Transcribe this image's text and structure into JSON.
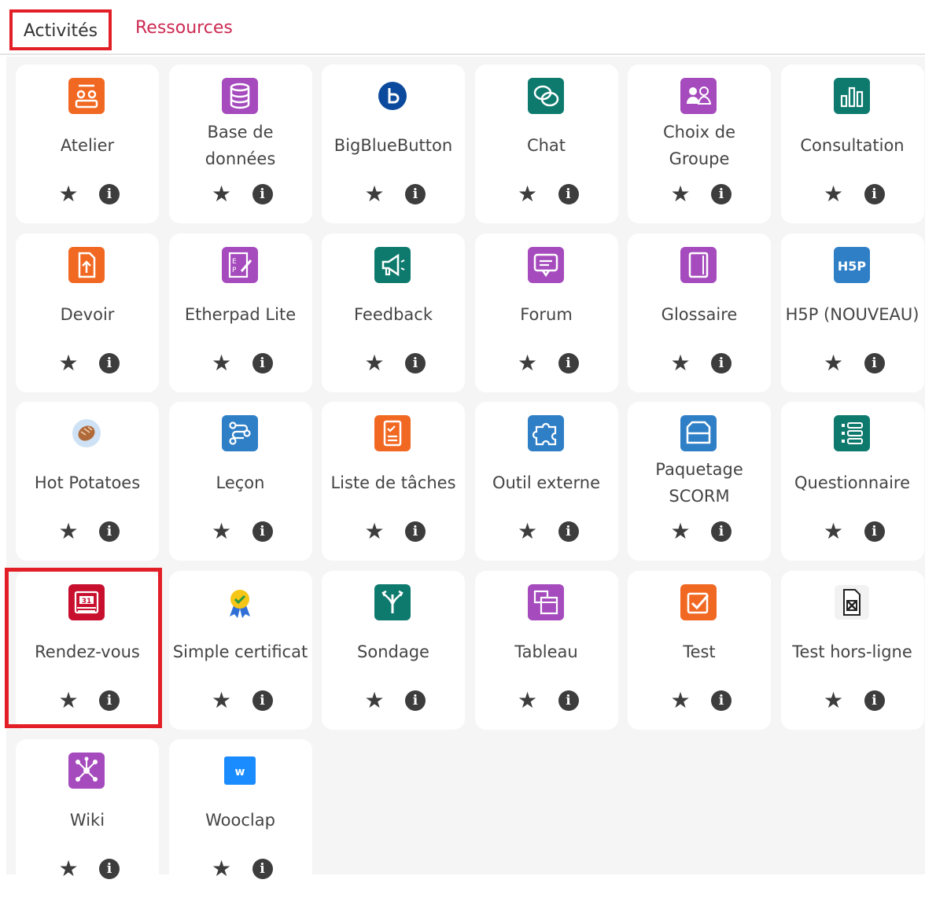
{
  "tabs": {
    "activities": "Activités",
    "resources": "Ressources"
  },
  "colors": {
    "orange": "#f16822",
    "purple": "#a54bbd",
    "teal": "#0e7a6e",
    "blue": "#2f7fc6",
    "crimson": "#c8102e",
    "active_tab_border": "#e21f26",
    "link": "#cc2a52"
  },
  "tiles": [
    {
      "label": "Atelier",
      "icon": "workshop-icon"
    },
    {
      "label": "Base de données",
      "icon": "database-icon"
    },
    {
      "label": "BigBlueButton",
      "icon": "bigbluebutton-icon"
    },
    {
      "label": "Chat",
      "icon": "chat-icon"
    },
    {
      "label": "Choix de Groupe",
      "icon": "group-choice-icon"
    },
    {
      "label": "Consultation",
      "icon": "poll-chart-icon"
    },
    {
      "label": "Devoir",
      "icon": "assignment-icon"
    },
    {
      "label": "Etherpad Lite",
      "icon": "etherpad-icon"
    },
    {
      "label": "Feedback",
      "icon": "megaphone-icon"
    },
    {
      "label": "Forum",
      "icon": "forum-icon"
    },
    {
      "label": "Glossaire",
      "icon": "glossary-book-icon"
    },
    {
      "label": "H5P (NOUVEAU)",
      "icon": "h5p-icon"
    },
    {
      "label": "Hot Potatoes",
      "icon": "hot-potatoes-icon"
    },
    {
      "label": "Leçon",
      "icon": "lesson-flow-icon"
    },
    {
      "label": "Liste de tâches",
      "icon": "checklist-icon"
    },
    {
      "label": "Outil externe",
      "icon": "puzzle-icon"
    },
    {
      "label": "Paquetage SCORM",
      "icon": "package-box-icon"
    },
    {
      "label": "Questionnaire",
      "icon": "questionnaire-list-icon"
    },
    {
      "label": "Rendez-vous",
      "icon": "scheduler-calendar-icon"
    },
    {
      "label": "Simple certificat",
      "icon": "certificate-ribbon-icon"
    },
    {
      "label": "Sondage",
      "icon": "survey-signpost-icon"
    },
    {
      "label": "Tableau",
      "icon": "board-icon"
    },
    {
      "label": "Test",
      "icon": "quiz-checkbox-icon"
    },
    {
      "label": "Test hors-ligne",
      "icon": "offline-quiz-icon"
    },
    {
      "label": "Wiki",
      "icon": "wiki-network-icon"
    },
    {
      "label": "Wooclap",
      "icon": "wooclap-icon"
    }
  ]
}
